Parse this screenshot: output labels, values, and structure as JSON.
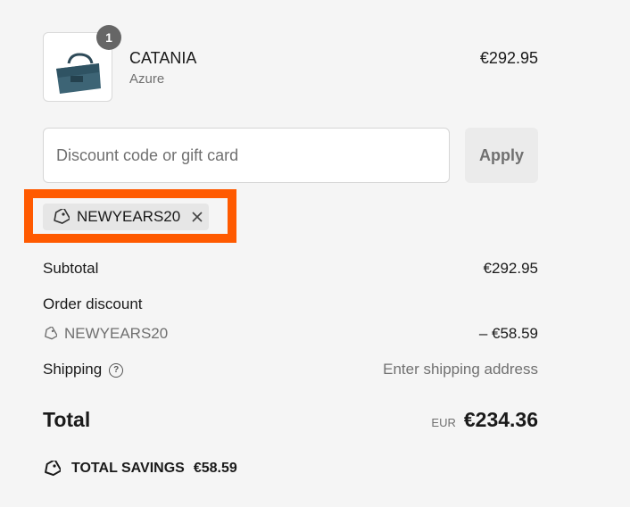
{
  "product": {
    "quantity": "1",
    "name": "CATANIA",
    "variant": "Azure",
    "price": "€292.95",
    "image_icon": "bag-image"
  },
  "discount": {
    "placeholder": "Discount code or gift card",
    "apply_label": "Apply"
  },
  "applied_code": {
    "code": "NEWYEARS20",
    "highlight_color": "#ff5a00"
  },
  "summary": {
    "subtotal_label": "Subtotal",
    "subtotal_value": "€292.95",
    "order_discount_label": "Order discount",
    "discount_code": "NEWYEARS20",
    "discount_value": "– €58.59",
    "shipping_label": "Shipping",
    "shipping_value": "Enter shipping address",
    "total_label": "Total",
    "currency": "EUR",
    "total_value": "€234.36",
    "savings_label": "TOTAL SAVINGS",
    "savings_value": "€58.59"
  }
}
